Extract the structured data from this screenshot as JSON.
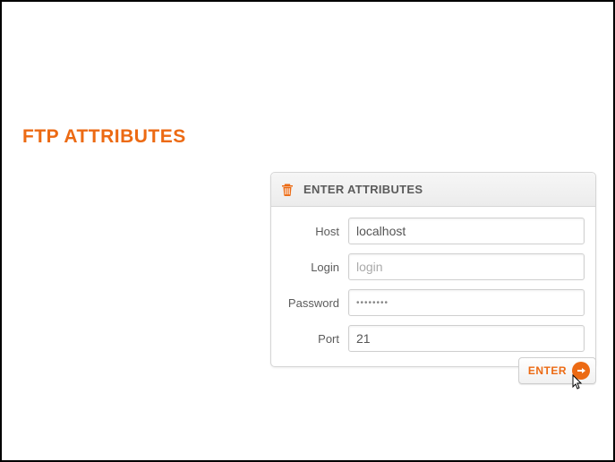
{
  "page_title": "FTP ATTRIBUTES",
  "panel": {
    "title": "ENTER ATTRIBUTES",
    "icon": "trash-icon"
  },
  "form": {
    "host": {
      "label": "Host",
      "value": "localhost"
    },
    "login": {
      "label": "Login",
      "value": "",
      "placeholder": "login"
    },
    "password": {
      "label": "Password",
      "value": "••••••••"
    },
    "port": {
      "label": "Port",
      "value": "21"
    }
  },
  "enter_button": {
    "label": "ENTER",
    "icon": "arrow-right-icon"
  },
  "colors": {
    "accent": "#ec6a13"
  }
}
